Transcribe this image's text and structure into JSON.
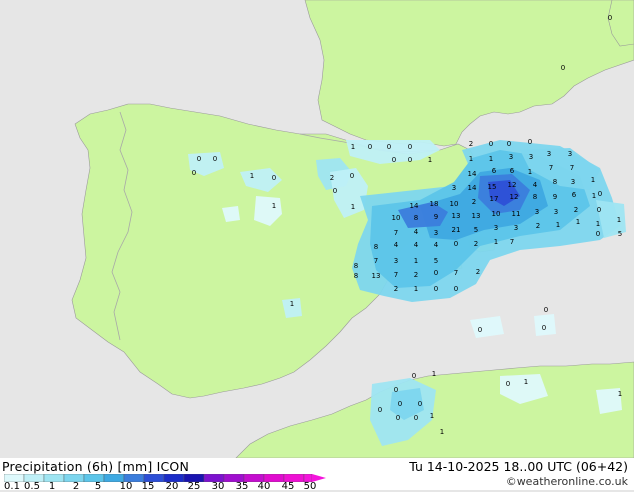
{
  "title": "Precipitation (6h) [mm] ICON",
  "run_label": "Tu 14-10-2025 18..00 UTC (06+42)",
  "credit": "©weatheronline.co.uk",
  "colors": {
    "sea": "#e6e6e6",
    "land": "#ccf5a0",
    "border": "#a8a8a8",
    "scale": [
      "#def9fc",
      "#bff0f7",
      "#9ee5f2",
      "#7dd6ee",
      "#5cc5e9",
      "#3ea9e2",
      "#3b7ddc",
      "#2d4fd6",
      "#1c2dc8",
      "#1a14b0",
      "#7d12cf",
      "#a00fcf",
      "#c40ecf",
      "#e00ccf",
      "#ee11d4",
      "#f414dc"
    ]
  },
  "legend": {
    "ticks": [
      "0.1",
      "0.5",
      "1",
      "2",
      "5",
      "10",
      "15",
      "20",
      "25",
      "30",
      "35",
      "40",
      "45",
      "50"
    ]
  },
  "map_values": [
    "0",
    "0",
    "0",
    "1",
    "0",
    "2",
    "0",
    "0",
    "1",
    "1",
    "1",
    "1",
    "0",
    "0",
    "0",
    "1",
    "0",
    "0",
    "2",
    "0",
    "0",
    "0",
    "1",
    "1",
    "3",
    "3",
    "3",
    "3",
    "14",
    "6",
    "6",
    "1",
    "3",
    "14",
    "15",
    "12",
    "4",
    "8",
    "3",
    "1",
    "7",
    "7",
    "1",
    "14",
    "18",
    "10",
    "2",
    "17",
    "12",
    "8",
    "9",
    "6",
    "10",
    "8",
    "9",
    "13",
    "13",
    "10",
    "11",
    "3",
    "3",
    "2",
    "0",
    "1",
    "7",
    "4",
    "3",
    "21",
    "5",
    "3",
    "3",
    "2",
    "1",
    "1",
    "1",
    "5",
    "8",
    "4",
    "4",
    "4",
    "0",
    "2",
    "1",
    "7",
    "8",
    "7",
    "3",
    "1",
    "5",
    "8",
    "13",
    "7",
    "2",
    "0",
    "7",
    "2",
    "2",
    "1",
    "0",
    "0",
    "0",
    "0",
    "0",
    "0",
    "1",
    "0",
    "0",
    "0",
    "0",
    "0",
    "0",
    "1",
    "1",
    "0",
    "1",
    "0",
    "0",
    "0",
    "0",
    "1"
  ]
}
